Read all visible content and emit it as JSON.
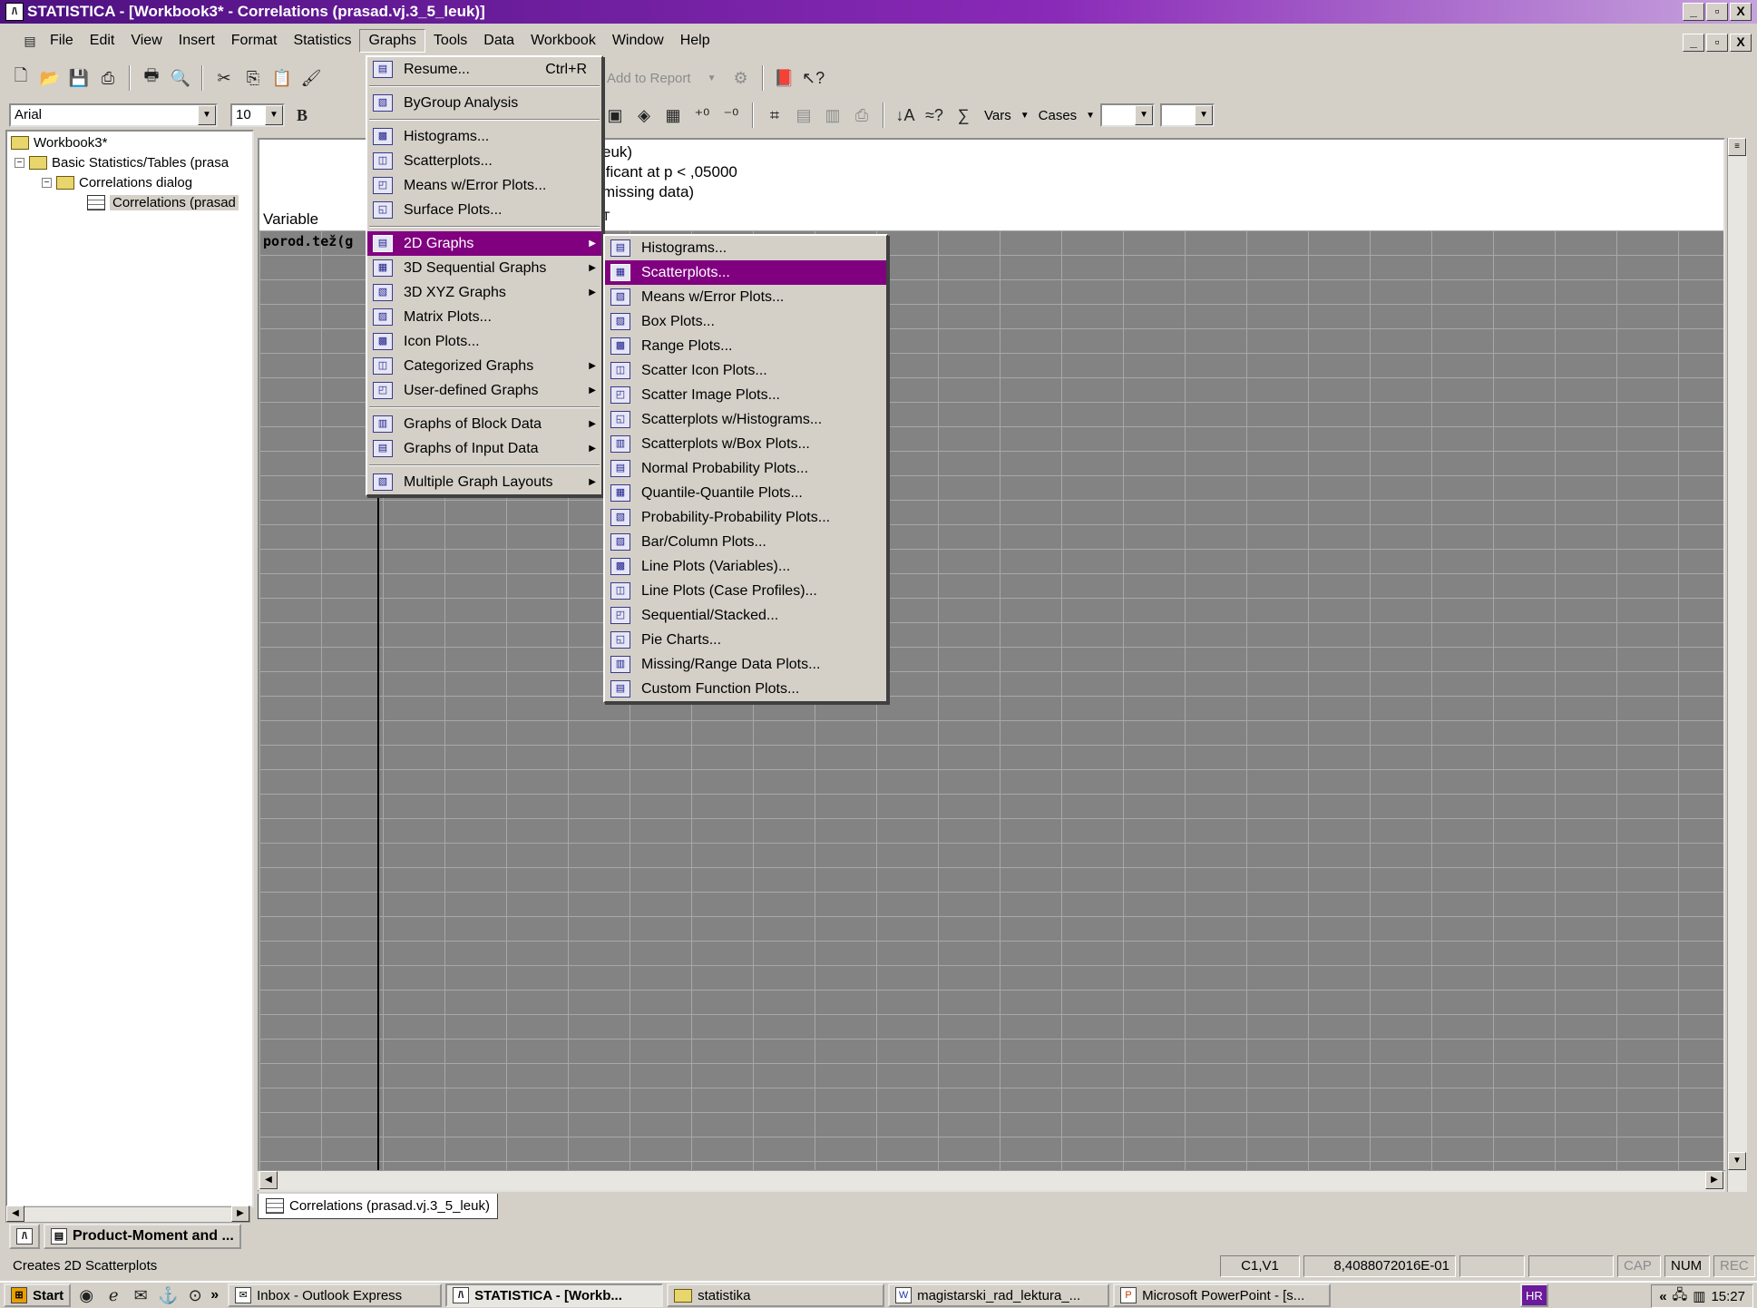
{
  "window": {
    "title": "STATISTICA - [Workbook3* - Correlations (prasad.vj.3_5_leuk)]",
    "app_icon": "statistica-icon",
    "controls": [
      "_",
      "▫",
      "X"
    ]
  },
  "menubar": {
    "items": [
      "File",
      "Edit",
      "View",
      "Insert",
      "Format",
      "Statistics",
      "Graphs",
      "Tools",
      "Data",
      "Workbook",
      "Window",
      "Help"
    ],
    "open_item": "Graphs"
  },
  "toolbar": {
    "add_to_report": "Add to Report",
    "font_name": "Arial",
    "font_size": "10",
    "bold": "B",
    "vars": "Vars",
    "cases": "Cases"
  },
  "tree": {
    "root": "Workbook3*",
    "child": "Basic Statistics/Tables (prasa",
    "grandchild": "Correlations dialog",
    "leaf": "Correlations (prasad"
  },
  "spreadsheet": {
    "header_lines": [
      "euk)",
      "ificant at p < ,05000",
      "missing data)"
    ],
    "column_header": "Variable",
    "column_header_2": "T",
    "first_row_label": "porod.tež(g"
  },
  "graphs_menu": {
    "items": [
      {
        "label": "Resume...",
        "shortcut": "Ctrl+R",
        "icon": "resume-icon",
        "submenu": false
      },
      {
        "sep": true
      },
      {
        "label": "ByGroup Analysis",
        "icon": "bygroup-icon",
        "submenu": false
      },
      {
        "sep": true
      },
      {
        "label": "Histograms...",
        "icon": "histogram-icon",
        "submenu": false
      },
      {
        "label": "Scatterplots...",
        "icon": "scatterplot-icon",
        "submenu": false
      },
      {
        "label": "Means w/Error Plots...",
        "icon": "means-error-icon",
        "submenu": false
      },
      {
        "label": "Surface Plots...",
        "icon": "surface-icon",
        "submenu": false
      },
      {
        "sep": true
      },
      {
        "label": "2D Graphs",
        "icon": "graph-2d-icon",
        "submenu": true,
        "highlighted": true
      },
      {
        "label": "3D Sequential Graphs",
        "icon": "graph-3d-seq-icon",
        "submenu": true
      },
      {
        "label": "3D XYZ Graphs",
        "icon": "graph-3d-xyz-icon",
        "submenu": true
      },
      {
        "label": "Matrix Plots...",
        "icon": "matrix-icon",
        "submenu": false
      },
      {
        "label": "Icon Plots...",
        "icon": "icon-plot-icon",
        "submenu": false
      },
      {
        "label": "Categorized Graphs",
        "icon": "categorized-icon",
        "submenu": true
      },
      {
        "label": "User-defined Graphs",
        "icon": "user-defined-icon",
        "submenu": true
      },
      {
        "sep": true
      },
      {
        "label": "Graphs of Block Data",
        "icon": "block-data-icon",
        "submenu": true
      },
      {
        "label": "Graphs of Input Data",
        "icon": "input-data-icon",
        "submenu": true
      },
      {
        "sep": true
      },
      {
        "label": "Multiple Graph Layouts",
        "icon": "layouts-icon",
        "submenu": true
      }
    ]
  },
  "graphs_2d_submenu": {
    "items": [
      {
        "label": "Histograms...",
        "icon": "histogram-icon"
      },
      {
        "label": "Scatterplots...",
        "icon": "scatterplot-icon",
        "highlighted": true
      },
      {
        "label": "Means w/Error Plots...",
        "icon": "means-error-icon"
      },
      {
        "label": "Box Plots...",
        "icon": "box-plot-icon"
      },
      {
        "label": "Range Plots...",
        "icon": "range-plot-icon"
      },
      {
        "label": "Scatter Icon Plots...",
        "icon": "scatter-icon-plot-icon"
      },
      {
        "label": "Scatter Image Plots...",
        "icon": "scatter-image-icon"
      },
      {
        "label": "Scatterplots w/Histograms...",
        "icon": "scatter-hist-icon"
      },
      {
        "label": "Scatterplots w/Box Plots...",
        "icon": "scatter-box-icon"
      },
      {
        "label": "Normal Probability Plots...",
        "icon": "normal-prob-icon"
      },
      {
        "label": "Quantile-Quantile Plots...",
        "icon": "qq-plot-icon"
      },
      {
        "label": "Probability-Probability Plots...",
        "icon": "pp-plot-icon"
      },
      {
        "label": "Bar/Column Plots...",
        "icon": "bar-column-icon"
      },
      {
        "label": "Line Plots (Variables)...",
        "icon": "line-plot-icon"
      },
      {
        "label": "Line Plots (Case Profiles)...",
        "icon": "line-profile-icon"
      },
      {
        "label": "Sequential/Stacked...",
        "icon": "stacked-icon"
      },
      {
        "label": "Pie Charts...",
        "icon": "pie-chart-icon"
      },
      {
        "label": "Missing/Range Data Plots...",
        "icon": "missing-data-icon"
      },
      {
        "label": "Custom Function Plots...",
        "icon": "custom-function-icon"
      }
    ]
  },
  "sheet_tab": "Correlations (prasad.vj.3_5_leuk)",
  "output_button": "Product-Moment and ...",
  "statusbar": {
    "message": "Creates 2D Scatterplots",
    "cell": "C1,V1",
    "value": "8,4088072016E-01",
    "cap": "CAP",
    "num": "NUM",
    "rec": "REC"
  },
  "taskbar": {
    "start": "Start",
    "chevron": "»",
    "tasks": [
      {
        "label": "Inbox - Outlook Express",
        "active": false
      },
      {
        "label": "STATISTICA - [Workb...",
        "active": true
      },
      {
        "label": "statistika",
        "active": false
      },
      {
        "label": "magistarski_rad_lektura_...",
        "active": false
      },
      {
        "label": "Microsoft PowerPoint - [s...",
        "active": false
      }
    ],
    "language": "HR",
    "tray_chevron": "«",
    "clock": "15:27"
  }
}
